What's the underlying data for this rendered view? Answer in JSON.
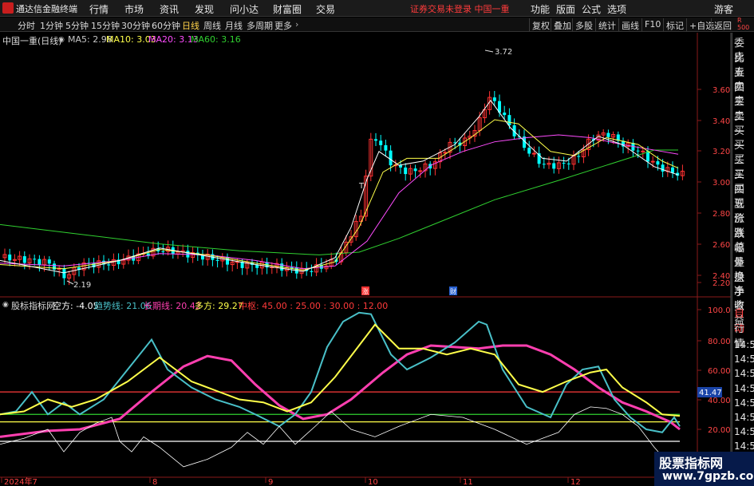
{
  "titlebar": {
    "app_name": "通达信金融终端",
    "menus": [
      "行情",
      "市场",
      "资讯",
      "发现",
      "问小达",
      "财富圈",
      "交易"
    ],
    "notice": "证券交易未登录  中国一重",
    "right_menus": [
      "功能",
      "版面",
      "公式",
      "选项"
    ],
    "guest": "游客"
  },
  "toolbar": {
    "periods": [
      "分时",
      "1分钟",
      "5分钟",
      "15分钟",
      "30分钟",
      "60分钟",
      "日线",
      "周线",
      "月线",
      "多周期",
      "更多"
    ],
    "active": "日线",
    "buttons": [
      "复权",
      "叠加",
      "多股",
      "统计",
      "画线",
      "F10",
      "标记",
      "+自选",
      "返回"
    ]
  },
  "main_chart": {
    "stock": "中国一重(日线)",
    "ma": [
      {
        "label": "MA5: 2.98",
        "color": "#ffffff"
      },
      {
        "label": "MA10: 3.03",
        "color": "#ffff4a"
      },
      {
        "label": "MA20: 3.13",
        "color": "#ff4cff"
      },
      {
        "label": "MA60: 3.16",
        "color": "#30d030"
      }
    ],
    "price_ticks": [
      "3.60",
      "3.40",
      "3.20",
      "3.00",
      "2.80",
      "2.60",
      "2.40",
      "2.20"
    ],
    "high_label": "3.72",
    "low_label": "2.19",
    "event_labels": [
      "涨",
      "财"
    ],
    "t_marks": [
      "T",
      "T"
    ]
  },
  "indicator": {
    "name": "股标指标网",
    "items": [
      {
        "label": "空方: -4.05",
        "color": "#ffffff"
      },
      {
        "label": "趋势线: 21.06",
        "color": "#49c0c8"
      },
      {
        "label": "长期线: 20.42",
        "color": "#ff3fb0"
      },
      {
        "label": "多方: 29.27",
        "color": "#ffff4a"
      },
      {
        "label": "中枢: 45.00 : 25.00 : 30.00 : 12.00",
        "color": "#ff3a3a"
      }
    ],
    "ticks": [
      "100.0",
      "80.00",
      "60.00",
      "40.00",
      "20.00"
    ],
    "value_badge": "41.47"
  },
  "time_axis": [
    "2024年7",
    "8",
    "9",
    "10",
    "11",
    "12"
  ],
  "right_panel": {
    "top": "R 500",
    "items": [
      "委比",
      "卖五",
      "卖四",
      "卖三",
      "卖二",
      "卖一",
      "买一",
      "买二",
      "买三",
      "买四",
      "买五",
      "现价",
      "涨跌",
      "涨幅",
      "总量",
      "外盘",
      "换手",
      "净资",
      "收益"
    ],
    "red_items": [
      "自动",
      "行情"
    ],
    "times": [
      "14:56",
      "14:56",
      "14:56",
      "14:56",
      "14:56",
      "14:56",
      "14:56",
      "14:56",
      "14:56",
      "14:56"
    ]
  },
  "watermark": {
    "line1": "股票指标网",
    "line2": "www.7gpzb.com"
  },
  "colors": {
    "up": "#ff3232",
    "down": "#00ffff",
    "ma5": "#ffffff",
    "ma10": "#ffff4a",
    "ma20": "#ff4cff",
    "ma60": "#30d030"
  }
}
